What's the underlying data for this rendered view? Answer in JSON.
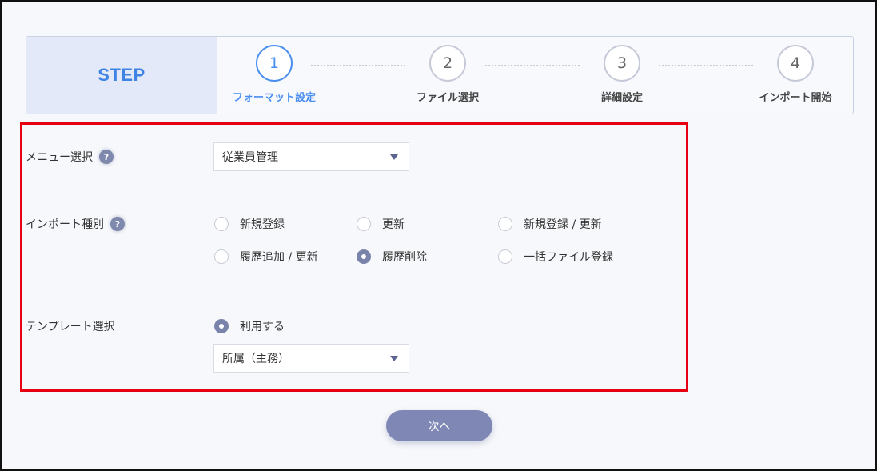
{
  "steps": {
    "label": "STEP",
    "items": [
      {
        "number": "1",
        "name": "フォーマット設定",
        "active": true
      },
      {
        "number": "2",
        "name": "ファイル選択",
        "active": false
      },
      {
        "number": "3",
        "name": "詳細設定",
        "active": false
      },
      {
        "number": "4",
        "name": "インポート開始",
        "active": false
      }
    ]
  },
  "form": {
    "menu": {
      "label": "メニュー選択",
      "help": "?",
      "selected": "従業員管理"
    },
    "import_type": {
      "label": "インポート種別",
      "help": "?",
      "options": [
        {
          "label": "新規登録",
          "checked": false
        },
        {
          "label": "更新",
          "checked": false
        },
        {
          "label": "新規登録 / 更新",
          "checked": false
        },
        {
          "label": "履歴追加 / 更新",
          "checked": false
        },
        {
          "label": "履歴削除",
          "checked": true
        },
        {
          "label": "一括ファイル登録",
          "checked": false
        }
      ]
    },
    "template": {
      "label": "テンプレート選択",
      "use_option": {
        "label": "利用する",
        "checked": true
      },
      "selected": "所属（主務）"
    }
  },
  "next_button": "次へ",
  "colors": {
    "accent": "#4a8ef0",
    "step_label": "#3f84e5",
    "highlight_border": "#e60012",
    "radio_checked": "#7a84ab",
    "button": "#7f88b5"
  }
}
